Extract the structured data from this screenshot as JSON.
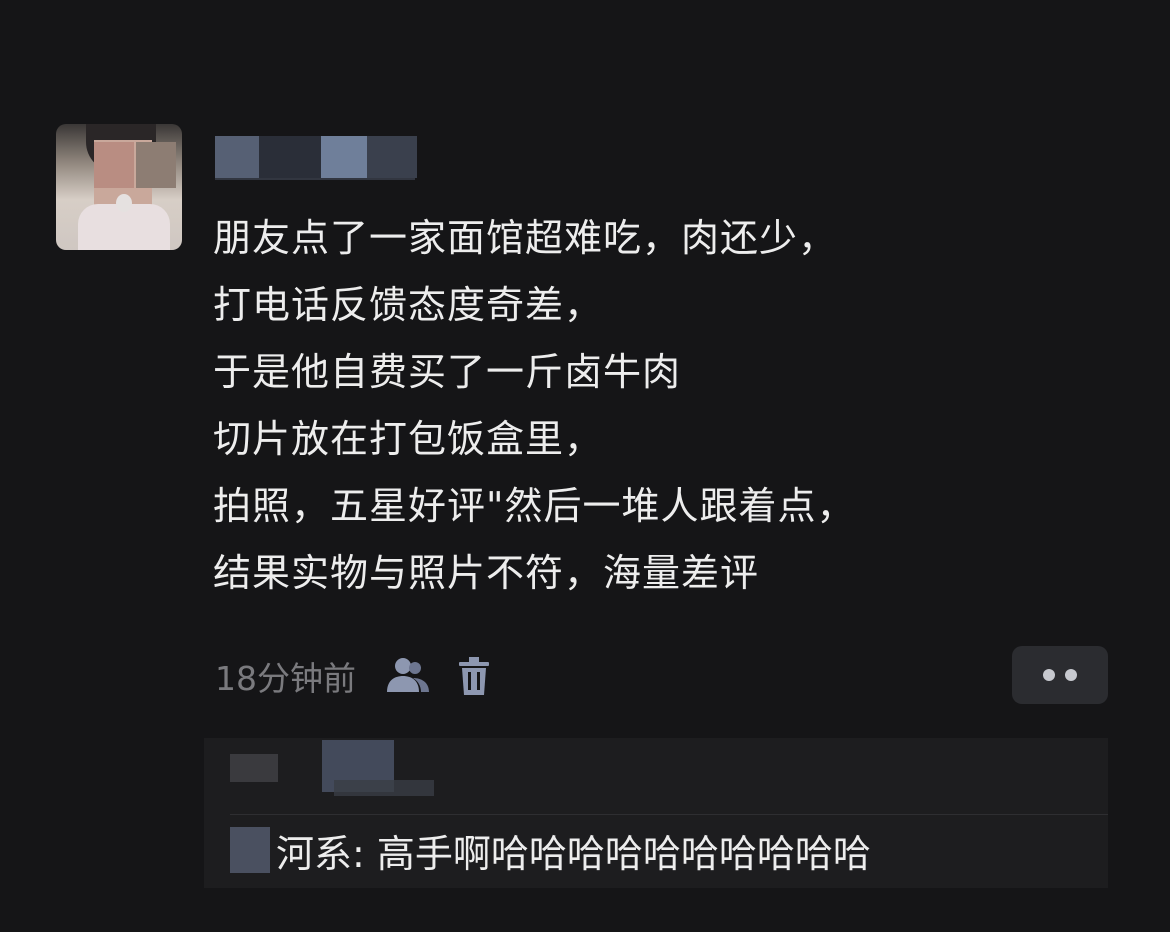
{
  "post": {
    "lines": [
      "朋友点了一家面馆超难吃，肉还少，",
      "打电话反馈态度奇差，",
      "于是他自费买了一斤卤牛肉",
      "切片放在打包饭盒里，",
      "拍照，五星好评\"然后一堆人跟着点，",
      "结果实物与照片不符，海量差评"
    ],
    "time": "18分钟前",
    "icons": {
      "visibility": "user-group-icon",
      "delete": "trash-icon",
      "more": "more-dots-icon"
    }
  },
  "comment": {
    "text": "河系: 高手啊哈哈哈哈哈哈哈哈哈哈"
  },
  "colors": {
    "background": "#151517",
    "text": "#ededed",
    "secondary": "#7a7a7e",
    "icon": "#8d97b0",
    "panel": "#1d1d1f"
  }
}
